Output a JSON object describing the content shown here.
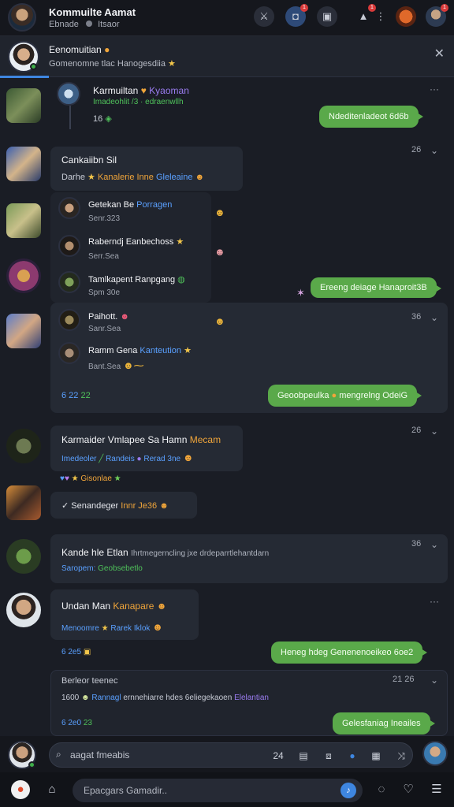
{
  "topbar": {
    "title": "Kommuilte Aamat",
    "subtitle": "Ebnade",
    "status": "Itsaor"
  },
  "banner": {
    "name": "Eenomuitian",
    "desc": "Gomenomne tlac Hanogesdiia"
  },
  "feed": {
    "msg1": {
      "name": "Karmuiltan",
      "tag": "Kyaoman",
      "line2": "Imadeohlit /3 · edraenwllh",
      "count": "16",
      "bubble": "Ndeditenladeot 6d6b"
    },
    "msg2": {
      "title": "Cankaiibn Sil",
      "line": "Darhe",
      "line_orange": "Kanalerie Inne",
      "line_blue": "Gleleaine",
      "time": "26",
      "replies": [
        {
          "name": "Getekan Be",
          "tag": "Porragen",
          "sub": "Senr.323"
        },
        {
          "name": "Raberndj Eanbechoss",
          "tag": "",
          "sub": "Serr.Sea"
        },
        {
          "name": "Tamlkapent Ranpgang",
          "tag": "",
          "sub": "Spm 30e"
        },
        {
          "name": "Paihott.",
          "tag": "",
          "sub": "Sanr.Sea"
        },
        {
          "name": "Ramm Gena",
          "tag": "Kanteution",
          "sub": "Bant.Sea"
        }
      ],
      "bubble1": "Ereeng deiage Hanaproit3B",
      "time2": "36",
      "footer_left": "6 22",
      "footer_green": "22",
      "bubble2_pre": "Geoobpeulka",
      "bubble2_post": "mengrelng OdeiG"
    },
    "msg3": {
      "title": "Karmaider Vmlapee Sa Hamn",
      "title_accent": "Mecam",
      "line_blue": "Imedeoler",
      "line_b2": "Randeis",
      "line_b3": "Rerad 3ne",
      "time": "26",
      "chip_line": "Gisonlae",
      "reply": "Senandeger",
      "reply_accent": "Innr Je36"
    },
    "msg4": {
      "title": "Kande hle Etlan",
      "desc": "Ihrtmegerncling jxe drdeparrtlehantdarn",
      "line_blue": "Saropem:",
      "line_green": "Geobsebetlo",
      "time": "36"
    },
    "msg5": {
      "title": "Undan Man",
      "title_accent": "Kanapare",
      "line_blue": "Menoomre",
      "line_b2": "Rarek",
      "line_b3": "Iklok",
      "footer_left": "6 2e5",
      "bubble": "Heneg hdeg Genenenoeikeo 6oe2"
    },
    "msg6": {
      "title": "Berleor teenec",
      "time": "21 26",
      "line_pre": "1600",
      "line_blue": "Rannagl",
      "line_mid": "ernnehiarre hdes 6eliegekaoen",
      "line_purple": "Elelantian",
      "footer_left": "6 2e0",
      "footer_green": "23",
      "bubble": "Gelesfaniag Ineailes"
    }
  },
  "composer": {
    "placeholder": "aagat fmeabis",
    "count": "24"
  },
  "bottombar": {
    "placeholder": "Epacgars Gamadir.."
  }
}
